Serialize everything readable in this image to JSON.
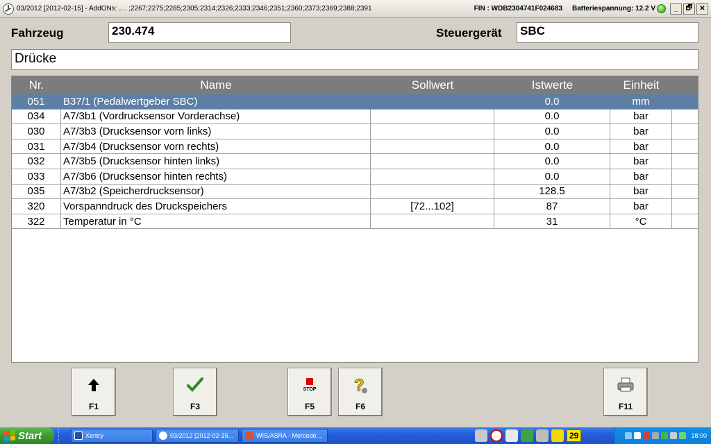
{
  "titlebar": {
    "caption": "03/2012 [2012-02-15] - AddONs:  .... ;2267;2275;2285;2305;2314;2326;2333;2346;2351;2360;2373;2369;2388;2391",
    "fin": "FIN : WDB2304741F024683",
    "battery": "Batteriespannung: 12.2 V",
    "minimize": "_",
    "restore": "🗗",
    "close": "✕"
  },
  "header": {
    "vehicle_label": "Fahrzeug",
    "vehicle_value": "230.474",
    "ecu_label": "Steuergerät",
    "ecu_value": "SBC",
    "section_title": "Drücke"
  },
  "table": {
    "columns": [
      "Nr.",
      "Name",
      "Sollwert",
      "Istwerte",
      "Einheit"
    ],
    "rows": [
      {
        "nr": "051",
        "name": "B37/1 (Pedalwertgeber SBC)",
        "soll": "",
        "ist": "0.0",
        "unit": "mm",
        "selected": true
      },
      {
        "nr": "034",
        "name": "A7/3b1 (Vordrucksensor Vorderachse)",
        "soll": "",
        "ist": "0.0",
        "unit": "bar",
        "selected": false
      },
      {
        "nr": "030",
        "name": "A7/3b3 (Drucksensor vorn links)",
        "soll": "",
        "ist": "0.0",
        "unit": "bar",
        "selected": false
      },
      {
        "nr": "031",
        "name": "A7/3b4 (Drucksensor vorn rechts)",
        "soll": "",
        "ist": "0.0",
        "unit": "bar",
        "selected": false
      },
      {
        "nr": "032",
        "name": "A7/3b5 (Drucksensor hinten links)",
        "soll": "",
        "ist": "0.0",
        "unit": "bar",
        "selected": false
      },
      {
        "nr": "033",
        "name": "A7/3b6 (Drucksensor hinten rechts)",
        "soll": "",
        "ist": "0.0",
        "unit": "bar",
        "selected": false
      },
      {
        "nr": "035",
        "name": "A7/3b2 (Speicherdrucksensor)",
        "soll": "",
        "ist": "128.5",
        "unit": "bar",
        "selected": false
      },
      {
        "nr": "320",
        "name": "Vorspanndruck des Druckspeichers",
        "soll": "[72...102]",
        "ist": "87",
        "unit": "bar",
        "selected": false
      },
      {
        "nr": "322",
        "name": "Temperatur in °C",
        "soll": "",
        "ist": "31",
        "unit": "°C",
        "selected": false
      }
    ]
  },
  "fkeys": [
    {
      "label": "F1",
      "icon": "arrow-up-icon"
    },
    {
      "label": "F3",
      "icon": "checkmark-icon"
    },
    {
      "label": "F5",
      "icon": "stop-icon",
      "icon_text": "STOP"
    },
    {
      "label": "F6",
      "icon": "help-icon"
    },
    {
      "label": "F11",
      "icon": "printer-icon"
    }
  ],
  "taskbar": {
    "start_label": "Start",
    "tasks": [
      "Xentry",
      "03/2012 [2012-02-15...",
      "WIS/ASRA - Mercede..."
    ],
    "badge": "29",
    "clock": "18:00"
  },
  "colors": {
    "selected_row": "#5d7fa6",
    "table_header": "#7c7c7c",
    "check_green": "#2e8b1e",
    "stop_red": "#e00000"
  }
}
